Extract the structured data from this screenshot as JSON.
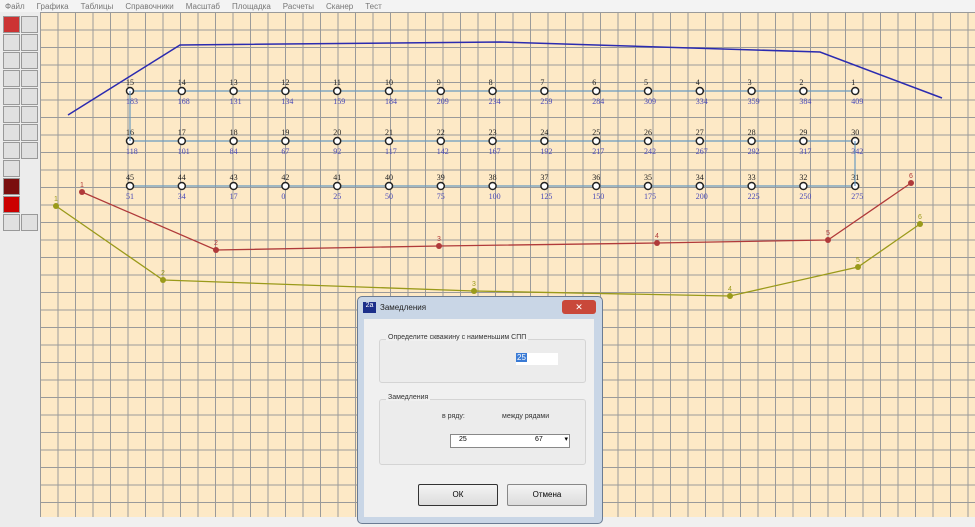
{
  "menu": [
    "Файл",
    "Графика",
    "Таблицы",
    "Справочники",
    "Масштаб",
    "Площадка",
    "Расчеты",
    "Сканер",
    "Тест"
  ],
  "rows": [
    {
      "nums": [
        "15",
        "14",
        "13",
        "12",
        "11",
        "10",
        "9",
        "8",
        "7",
        "6",
        "5",
        "4",
        "3",
        "2",
        "1"
      ],
      "delays": [
        "183",
        "168",
        "131",
        "134",
        "159",
        "184",
        "209",
        "234",
        "259",
        "284",
        "309",
        "334",
        "359",
        "384",
        "409"
      ]
    },
    {
      "nums": [
        "16",
        "17",
        "18",
        "19",
        "20",
        "21",
        "22",
        "23",
        "24",
        "25",
        "26",
        "27",
        "28",
        "29",
        "30"
      ],
      "delays": [
        "118",
        "101",
        "84",
        "67",
        "92",
        "117",
        "142",
        "167",
        "192",
        "217",
        "242",
        "267",
        "292",
        "317",
        "342"
      ]
    },
    {
      "nums": [
        "45",
        "44",
        "43",
        "42",
        "41",
        "40",
        "39",
        "38",
        "37",
        "36",
        "35",
        "34",
        "33",
        "32",
        "31"
      ],
      "delays": [
        "51",
        "34",
        "17",
        "0",
        "25",
        "50",
        "75",
        "100",
        "125",
        "150",
        "175",
        "200",
        "225",
        "250",
        "275"
      ]
    }
  ],
  "red_line_labels": [
    "1",
    "2",
    "3",
    "4",
    "5",
    "6"
  ],
  "olive_line_labels": [
    "1",
    "2",
    "3",
    "4",
    "5",
    "6"
  ],
  "colors": {
    "blue": "#2b2bb0",
    "red": "#b03a3a",
    "olive": "#9a9a1a",
    "delay": "#4a4ab8"
  },
  "dialog": {
    "title": "Замедления",
    "group1": "Определите скважину с наименьшим СПП",
    "well_value": "25",
    "group2": "Замедления",
    "in_row_label": "в ряду:",
    "between_rows_label": "между рядами",
    "in_row_value": "25",
    "between_rows_value": "67",
    "ok": "ОК",
    "cancel": "Отмена",
    "close": "✕"
  }
}
